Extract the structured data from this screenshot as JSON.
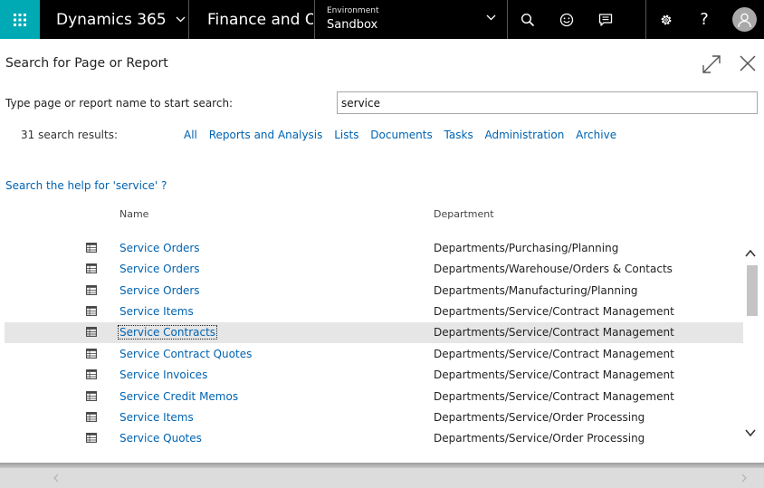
{
  "topbar": {
    "brand": "Dynamics 365",
    "app": "Finance and Op",
    "environment_label": "Environment",
    "environment_value": "Sandbox",
    "help_glyph": "?",
    "icons": [
      "app-launcher-icon",
      "chevron-down-icon",
      "search-icon",
      "smile-icon",
      "feedback-icon",
      "gear-icon",
      "user-icon"
    ]
  },
  "dialog": {
    "title": "Search for Page or Report",
    "search_label": "Type page or report name to start search:",
    "search_value": "service",
    "results_count": "31 search results:",
    "filters": [
      "All",
      "Reports and Analysis",
      "Lists",
      "Documents",
      "Tasks",
      "Administration",
      "Archive"
    ],
    "help_link": "Search the help for 'service' ?",
    "columns": {
      "name": "Name",
      "department": "Department"
    }
  },
  "results": [
    {
      "name": "Service Orders",
      "department": "Departments/Purchasing/Planning"
    },
    {
      "name": "Service Orders",
      "department": "Departments/Warehouse/Orders & Contacts"
    },
    {
      "name": "Service Orders",
      "department": "Departments/Manufacturing/Planning"
    },
    {
      "name": "Service Items",
      "department": "Departments/Service/Contract Management"
    },
    {
      "name": "Service Contracts",
      "department": "Departments/Service/Contract Management",
      "selected": true
    },
    {
      "name": "Service Contract Quotes",
      "department": "Departments/Service/Contract Management"
    },
    {
      "name": "Service Invoices",
      "department": "Departments/Service/Contract Management"
    },
    {
      "name": "Service Credit Memos",
      "department": "Departments/Service/Contract Management"
    },
    {
      "name": "Service Items",
      "department": "Departments/Service/Order Processing"
    },
    {
      "name": "Service Quotes",
      "department": "Departments/Service/Order Processing"
    }
  ],
  "scroll": {
    "visible_fraction": 0.32,
    "offset_fraction": 0.0
  },
  "colors": {
    "accent": "#00aab4",
    "topbar": "#000000",
    "link": "#0063b1",
    "selected_row": "#e6e6e6"
  }
}
